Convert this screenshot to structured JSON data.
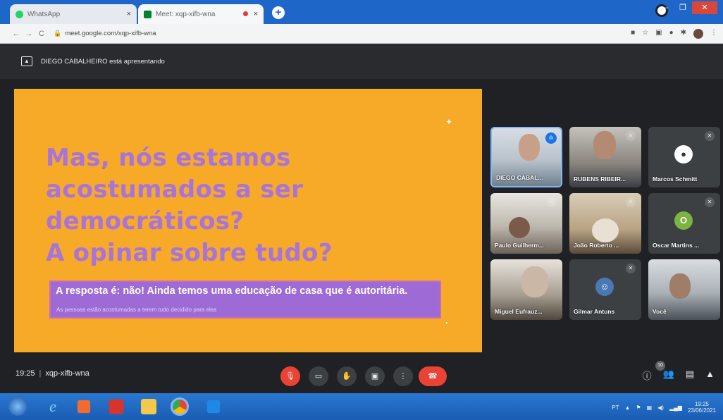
{
  "browser": {
    "tabs": [
      {
        "label": "WhatsApp",
        "close": "×"
      },
      {
        "label": "Meet: xqp-xifb-wna",
        "close": "×"
      }
    ],
    "new_tab": "+",
    "url": "meet.google.com/xqp-xifb-wna",
    "window_controls": [
      "—",
      "❐",
      "✕"
    ]
  },
  "meet": {
    "presenting_banner": "DIEGO CABALHEIRO está apresentando",
    "slide": {
      "headline_lines": [
        "Mas, nós estamos",
        "acostumados a ser",
        "democráticos?",
        "A opinar sobre tudo?"
      ],
      "answer": "A resposta é: não! Ainda temos uma educação de casa que é autoritária.",
      "subtext": "As pessoas estão acostumadas a terem tudo decidido para elas"
    },
    "participants": [
      {
        "name": "DIEGO CABAL...",
        "type": "video",
        "speaking": true
      },
      {
        "name": "RUBENS RIBEIR...",
        "type": "video"
      },
      {
        "name": "Marcos Schmitt",
        "type": "avatar",
        "avatar_text": "◉",
        "avatar_color": "#ffffff"
      },
      {
        "name": "Paulo Guilherm...",
        "type": "video"
      },
      {
        "name": "João Roberto ...",
        "type": "video"
      },
      {
        "name": "Oscar Martins ...",
        "type": "avatar",
        "avatar_text": "O",
        "avatar_color": "#7cb342"
      },
      {
        "name": "Miguel Eufrauz...",
        "type": "video"
      },
      {
        "name": "Gilmar Antuns",
        "type": "avatar",
        "avatar_text": "☺",
        "avatar_color": "#4a78b5"
      },
      {
        "name": "Você",
        "type": "video"
      }
    ],
    "bottom": {
      "time": "19:25",
      "meeting_code": "xqp-xifb-wna",
      "participant_count": "10"
    }
  },
  "taskbar": {
    "lang": "PT",
    "time": "19:25",
    "date": "23/06/2021"
  },
  "colors": {
    "slide_bg": "#f7a928",
    "headline": "#a774db",
    "answer_box": "#9d6ad6",
    "meet_bg": "#202124",
    "hangup": "#ea4335"
  }
}
